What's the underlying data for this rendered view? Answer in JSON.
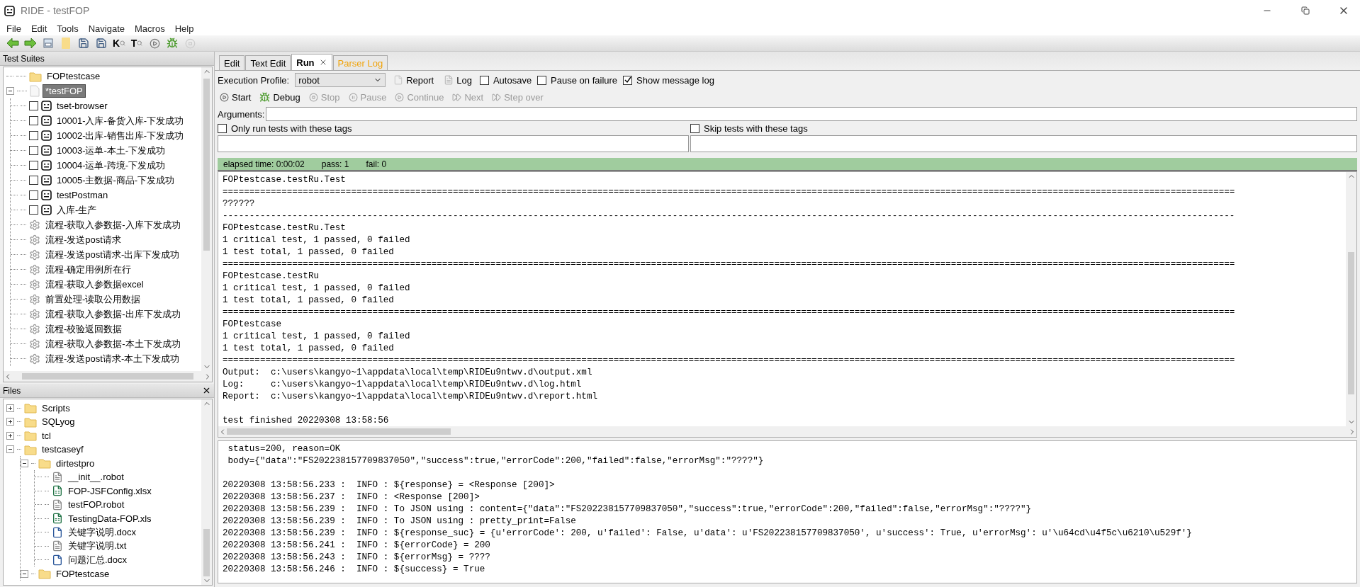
{
  "window": {
    "title": "RIDE - testFOP"
  },
  "menu": [
    "File",
    "Edit",
    "Tools",
    "Navigate",
    "Macros",
    "Help"
  ],
  "toolbar": [
    {
      "kind": "back"
    },
    {
      "kind": "forward"
    },
    {
      "kind": "open"
    },
    {
      "kind": "folder"
    },
    {
      "kind": "save"
    },
    {
      "kind": "save-all"
    },
    {
      "kind": "letter",
      "text": "K"
    },
    {
      "kind": "letter",
      "text": "T"
    },
    {
      "kind": "run"
    },
    {
      "kind": "debug"
    },
    {
      "kind": "stop"
    }
  ],
  "test_suites": {
    "title": "Test Suites",
    "tree": [
      {
        "label": "FOPtestcase",
        "kind": "folder",
        "selected": false
      },
      {
        "label": "*testFOP",
        "kind": "file",
        "selected": true,
        "expanded": true,
        "children": [
          {
            "label": "tset-browser",
            "kind": "test",
            "checked": false,
            "selected": false
          },
          {
            "label": "10001-入库-备货入库-下发成功",
            "kind": "test",
            "checked": false,
            "selected": false
          },
          {
            "label": "10002-出库-销售出库-下发成功",
            "kind": "test",
            "checked": false,
            "selected": false
          },
          {
            "label": "10003-运单-本土-下发成功",
            "kind": "test",
            "checked": false,
            "selected": false
          },
          {
            "label": "10004-运单-跨境-下发成功",
            "kind": "test",
            "checked": false,
            "selected": false
          },
          {
            "label": "10005-主数据-商品-下发成功",
            "kind": "test",
            "checked": false,
            "selected": false
          },
          {
            "label": "testPostman",
            "kind": "test",
            "checked": false,
            "selected": false
          },
          {
            "label": "入库-生产",
            "kind": "test",
            "checked": false,
            "selected": false
          },
          {
            "label": "流程-获取入参数据-入库下发成功",
            "kind": "keyword",
            "selected": false
          },
          {
            "label": "流程-发送post请求",
            "kind": "keyword",
            "selected": false
          },
          {
            "label": "流程-发送post请求-出库下发成功",
            "kind": "keyword",
            "selected": false
          },
          {
            "label": "流程-确定用例所在行",
            "kind": "keyword",
            "selected": false
          },
          {
            "label": "流程-获取入参数据excel",
            "kind": "keyword",
            "selected": false
          },
          {
            "label": "前置处理-读取公用数据",
            "kind": "keyword",
            "selected": false
          },
          {
            "label": "流程-获取入参数据-出库下发成功",
            "kind": "keyword",
            "selected": false
          },
          {
            "label": "流程-校验返回数据",
            "kind": "keyword",
            "selected": false
          },
          {
            "label": "流程-获取入参数据-本土下发成功",
            "kind": "keyword",
            "selected": false
          },
          {
            "label": "流程-发送post请求-本土下发成功",
            "kind": "keyword",
            "selected": false
          }
        ]
      }
    ]
  },
  "files": {
    "title": "Files",
    "tree": [
      {
        "label": "Scripts",
        "kind": "folder",
        "expanded": false
      },
      {
        "label": "SQLyog",
        "kind": "folder",
        "expanded": false
      },
      {
        "label": "tcl",
        "kind": "folder",
        "expanded": false
      },
      {
        "label": "testcaseyf",
        "kind": "folder",
        "expanded": true,
        "children": [
          {
            "label": "dirtestpro",
            "kind": "folder",
            "expanded": true,
            "children": [
              {
                "label": "__init__.robot",
                "kind": "text"
              },
              {
                "label": "FOP-JSFConfig.xlsx",
                "kind": "excel"
              },
              {
                "label": "testFOP.robot",
                "kind": "text"
              },
              {
                "label": "TestingData-FOP.xls",
                "kind": "excel"
              },
              {
                "label": "关键字说明.docx",
                "kind": "word"
              },
              {
                "label": "关键字说明.txt",
                "kind": "text"
              },
              {
                "label": "问题汇总.docx",
                "kind": "word"
              }
            ]
          },
          {
            "label": "FOPtestcase",
            "kind": "folder",
            "expanded": true
          }
        ]
      }
    ]
  },
  "tabs": [
    {
      "label": "Edit",
      "selected": false,
      "closable": false,
      "color": "#000000"
    },
    {
      "label": "Text Edit",
      "selected": false,
      "closable": false,
      "color": "#000000"
    },
    {
      "label": "Run",
      "selected": true,
      "closable": true,
      "color": "#000000"
    },
    {
      "label": "Parser Log",
      "selected": false,
      "closable": false,
      "color": "#f0a30a"
    }
  ],
  "run": {
    "profile_label": "Execution Profile:",
    "profile": "robot",
    "report": "Report",
    "log": "Log",
    "options": [
      {
        "label": "Autosave",
        "checked": false
      },
      {
        "label": "Pause on failure",
        "checked": false
      },
      {
        "label": "Show message log",
        "checked": true
      }
    ],
    "actions": [
      {
        "label": "Start",
        "kind": "play",
        "disabled": false
      },
      {
        "label": "Debug",
        "kind": "debug",
        "disabled": false
      },
      {
        "label": "Stop",
        "kind": "stop",
        "disabled": true
      },
      {
        "label": "Pause",
        "kind": "pause",
        "disabled": true
      },
      {
        "label": "Continue",
        "kind": "play",
        "disabled": true
      },
      {
        "label": "Next",
        "kind": "next",
        "disabled": true
      },
      {
        "label": "Step over",
        "kind": "next",
        "disabled": true
      }
    ],
    "arguments_label": "Arguments:",
    "include_tags": {
      "label": "Only run tests with these tags",
      "checked": false
    },
    "exclude_tags": {
      "label": "Skip tests with these tags",
      "checked": false
    },
    "status": {
      "elapsed": "elapsed time: 0:00:02",
      "pass": "pass: 1",
      "fail": "fail: 0"
    }
  },
  "output": [
    {
      "kind": "text",
      "text": "FOPtestcase.testRu.Test"
    },
    {
      "kind": "text",
      "text": "============================================================================================================================================================================================="
    },
    {
      "kind": "text",
      "text": "??????"
    },
    {
      "kind": "text",
      "text": "---------------------------------------------------------------------------------------------------------------------------------------------------------------------------------------------"
    },
    {
      "kind": "text",
      "text": "FOPtestcase.testRu.Test"
    },
    {
      "kind": "text",
      "text": "1 critical test, 1 passed, 0 failed"
    },
    {
      "kind": "text",
      "text": "1 test total, 1 passed, 0 failed"
    },
    {
      "kind": "text",
      "text": "============================================================================================================================================================================================="
    },
    {
      "kind": "text",
      "text": "FOPtestcase.testRu"
    },
    {
      "kind": "text",
      "text": "1 critical test, 1 passed, 0 failed"
    },
    {
      "kind": "text",
      "text": "1 test total, 1 passed, 0 failed"
    },
    {
      "kind": "text",
      "text": "============================================================================================================================================================================================="
    },
    {
      "kind": "text",
      "text": "FOPtestcase"
    },
    {
      "kind": "text",
      "text": "1 critical test, 1 passed, 0 failed"
    },
    {
      "kind": "text",
      "text": "1 test total, 1 passed, 0 failed"
    },
    {
      "kind": "text",
      "text": "============================================================================================================================================================================================="
    },
    {
      "kind": "text",
      "text": "Output:  c:\\users\\kangyo~1\\appdata\\local\\temp\\RIDEu9ntwv.d\\output.xml"
    },
    {
      "kind": "text",
      "text": "Log:     c:\\users\\kangyo~1\\appdata\\local\\temp\\RIDEu9ntwv.d\\log.html"
    },
    {
      "kind": "text",
      "text": "Report:  c:\\users\\kangyo~1\\appdata\\local\\temp\\RIDEu9ntwv.d\\report.html"
    },
    {
      "kind": "blank"
    },
    {
      "kind": "text",
      "text": "test finished 20220308 13:58:56"
    }
  ],
  "message_log": [
    {
      "kind": "text",
      "text": " status=200, reason=OK"
    },
    {
      "kind": "text",
      "text": " body={\"data\":\"FS202238157709837050\",\"success\":true,\"errorCode\":200,\"failed\":false,\"errorMsg\":\"????\"}"
    },
    {
      "kind": "blank"
    },
    {
      "kind": "text",
      "text": "20220308 13:58:56.233 :  INFO : ${response} = <Response [200]>"
    },
    {
      "kind": "text",
      "text": "20220308 13:58:56.237 :  INFO : <Response [200]>"
    },
    {
      "kind": "text",
      "text": "20220308 13:58:56.239 :  INFO : To JSON using : content={\"data\":\"FS202238157709837050\",\"success\":true,\"errorCode\":200,\"failed\":false,\"errorMsg\":\"????\"}"
    },
    {
      "kind": "text",
      "text": "20220308 13:58:56.239 :  INFO : To JSON using : pretty_print=False"
    },
    {
      "kind": "text",
      "text": "20220308 13:58:56.239 :  INFO : ${response_suc} = {u'errorCode': 200, u'failed': False, u'data': u'FS202238157709837050', u'success': True, u'errorMsg': u'\\u64cd\\u4f5c\\u6210\\u529f'}"
    },
    {
      "kind": "text",
      "text": "20220308 13:58:56.241 :  INFO : ${errorCode} = 200"
    },
    {
      "kind": "text",
      "text": "20220308 13:58:56.243 :  INFO : ${errorMsg} = ????"
    },
    {
      "kind": "text",
      "text": "20220308 13:58:56.246 :  INFO : ${success} = True"
    }
  ]
}
